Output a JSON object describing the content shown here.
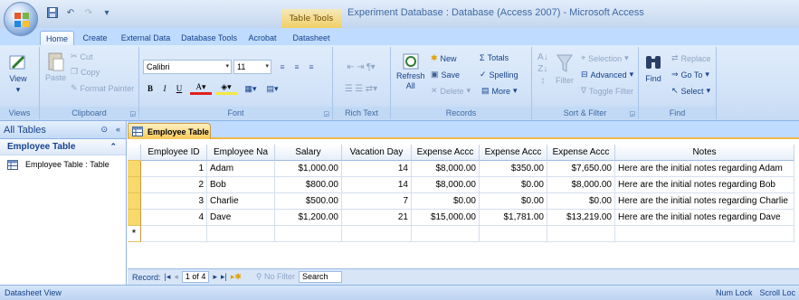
{
  "window": {
    "title": "Experiment Database : Database (Access 2007) - Microsoft Access",
    "contextual_tab": "Table Tools"
  },
  "tabs": [
    "Home",
    "Create",
    "External Data",
    "Database Tools",
    "Acrobat",
    "Datasheet"
  ],
  "ribbon": {
    "views": {
      "view": "View",
      "label": "Views"
    },
    "clipboard": {
      "paste": "Paste",
      "cut": "Cut",
      "copy": "Copy",
      "format_painter": "Format Painter",
      "label": "Clipboard"
    },
    "font": {
      "name": "Calibri",
      "size": "11",
      "bold": "B",
      "italic": "I",
      "underline": "U",
      "label": "Font"
    },
    "richtext": {
      "label": "Rich Text"
    },
    "records": {
      "refresh": "Refresh",
      "refresh_sub": "All",
      "new": "New",
      "save": "Save",
      "delete": "Delete",
      "totals": "Totals",
      "spelling": "Spelling",
      "more": "More",
      "label": "Records"
    },
    "sortfilter": {
      "filter": "Filter",
      "selection": "Selection",
      "advanced": "Advanced",
      "toggle_filter": "Toggle Filter",
      "label": "Sort & Filter"
    },
    "find": {
      "find": "Find",
      "replace": "Replace",
      "goto": "Go To",
      "select": "Select",
      "label": "Find"
    }
  },
  "nav": {
    "header": "All Tables",
    "group": "Employee Table",
    "item": "Employee Table : Table"
  },
  "document": {
    "tab": "Employee Table"
  },
  "table": {
    "columns": [
      "Employee ID",
      "Employee Na",
      "Salary",
      "Vacation Day",
      "Expense Accc",
      "Expense Accc",
      "Expense Accc",
      "Notes"
    ],
    "rows": [
      [
        "1",
        "Adam",
        "$1,000.00",
        "14",
        "$8,000.00",
        "$350.00",
        "$7,650.00",
        "Here are the initial notes regarding Adam"
      ],
      [
        "2",
        "Bob",
        "$800.00",
        "14",
        "$8,000.00",
        "$0.00",
        "$8,000.00",
        "Here are the initial notes regarding Bob"
      ],
      [
        "3",
        "Charlie",
        "$500.00",
        "7",
        "$0.00",
        "$0.00",
        "$0.00",
        "Here are the initial notes regarding Charlie"
      ],
      [
        "4",
        "Dave",
        "$1,200.00",
        "21",
        "$15,000.00",
        "$1,781.00",
        "$13,219.00",
        "Here are the initial notes regarding Dave"
      ]
    ],
    "new_row_marker": "*"
  },
  "record_nav": {
    "label": "Record:",
    "position": "1 of 4",
    "filter": "No Filter",
    "search": "Search"
  },
  "status": {
    "left": "Datasheet View",
    "num_lock": "Num Lock",
    "scroll_lock": "Scroll Loc"
  }
}
